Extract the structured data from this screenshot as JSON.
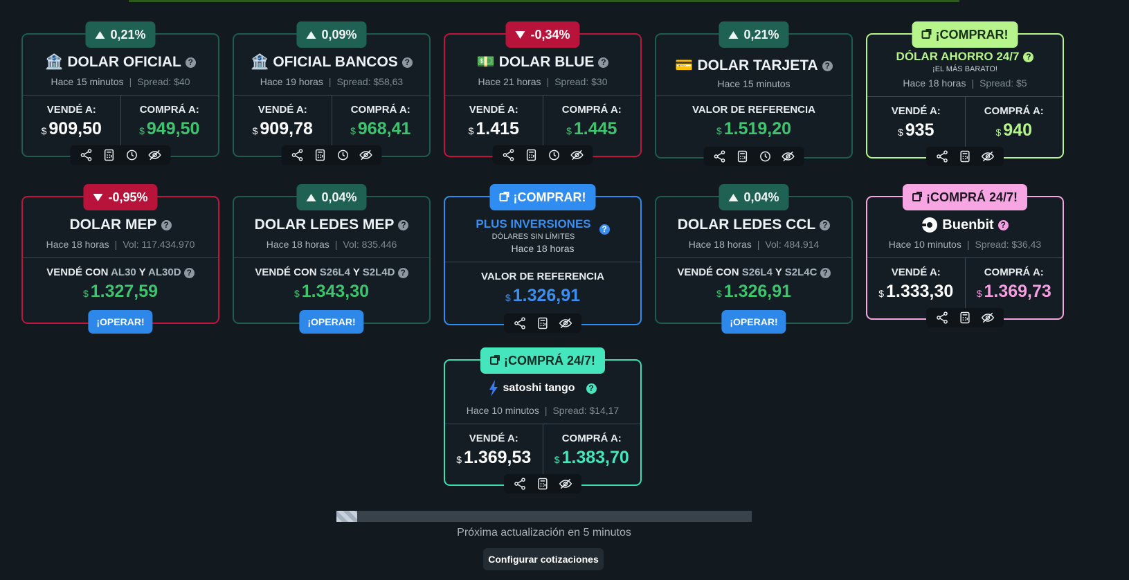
{
  "cards": [
    {
      "badge": "0,21%",
      "title": "DOLAR OFICIAL",
      "emoji": "🏦",
      "time": "Hace 15 minutos",
      "spread": "Spread: $40",
      "sell_label": "VENDÉ A:",
      "sell": "909,50",
      "buy_label": "COMPRÁ A:",
      "buy": "949,50"
    },
    {
      "badge": "0,09%",
      "title": "OFICIAL BANCOS",
      "emoji": "🏦",
      "time": "Hace 19 horas",
      "spread": "Spread: $58,63",
      "sell_label": "VENDÉ A:",
      "sell": "909,78",
      "buy_label": "COMPRÁ A:",
      "buy": "968,41"
    },
    {
      "badge": "-0,34%",
      "title": "DOLAR BLUE",
      "emoji": "💵",
      "time": "Hace 21 horas",
      "spread": "Spread: $30",
      "sell_label": "VENDÉ A:",
      "sell": "1.415",
      "buy_label": "COMPRÁ A:",
      "buy": "1.445"
    },
    {
      "badge": "0,21%",
      "title": "DOLAR TARJETA",
      "emoji": "💳",
      "time": "Hace 15 minutos",
      "ref_label": "VALOR DE REFERENCIA",
      "ref": "1.519,20"
    },
    {
      "badge": "¡COMPRAR!",
      "title": "DÓLAR AHORRO 24/7",
      "subtitle": "¡EL MÁS BARATO!",
      "time": "Hace 18 horas",
      "spread": "Spread: $5",
      "sell_label": "VENDÉ A:",
      "sell": "935",
      "buy_label": "COMPRÁ A:",
      "buy": "940"
    },
    {
      "badge": "-0,95%",
      "title": "DOLAR MEP",
      "time": "Hace 18 horas",
      "vol": "Vol: 117.434.970",
      "sell_text": "VENDÉ CON",
      "bond_a": "AL30",
      "and": "Y",
      "bond_b": "AL30D",
      "value": "1.327,59",
      "action": "¡OPERAR!"
    },
    {
      "badge": "0,04%",
      "title": "DOLAR LEDES MEP",
      "time": "Hace 18 horas",
      "vol": "Vol: 835.446",
      "sell_text": "VENDÉ CON",
      "bond_a": "S26L4",
      "and": "Y",
      "bond_b": "S2L4D",
      "value": "1.343,30",
      "action": "¡OPERAR!"
    },
    {
      "badge": "¡COMPRAR!",
      "title": "PLUS INVERSIONES",
      "subtitle": "DÓLARES SIN LÍMITES",
      "time": "Hace 18 horas",
      "ref_label": "VALOR DE REFERENCIA",
      "ref": "1.326,91"
    },
    {
      "badge": "0,04%",
      "title": "DOLAR LEDES CCL",
      "time": "Hace 18 horas",
      "vol": "Vol: 484.914",
      "sell_text": "VENDÉ CON",
      "bond_a": "S26L4",
      "and": "Y",
      "bond_b": "S2L4C",
      "value": "1.326,91",
      "action": "¡OPERAR!"
    },
    {
      "badge": "¡COMPRÁ 24/7!",
      "brand": "Buenbit",
      "time": "Hace 10 minutos",
      "spread": "Spread: $36,43",
      "sell_label": "VENDÉ A:",
      "sell": "1.333,30",
      "buy_label": "COMPRÁ A:",
      "buy": "1.369,73"
    },
    {
      "badge": "¡COMPRÁ 24/7!",
      "brand_a": "satoshi",
      "brand_b": "tango",
      "time": "Hace 10 minutos",
      "spread": "Spread: $14,17",
      "sell_label": "VENDÉ A:",
      "sell": "1.369,53",
      "buy_label": "COMPRÁ A:",
      "buy": "1.383,70"
    }
  ],
  "currency": "$",
  "help": "?",
  "separator": "|",
  "progress_fraction": 0.05,
  "footer": {
    "next_update": "Próxima actualización en 5 minutos",
    "config": "Configurar cotizaciones"
  }
}
